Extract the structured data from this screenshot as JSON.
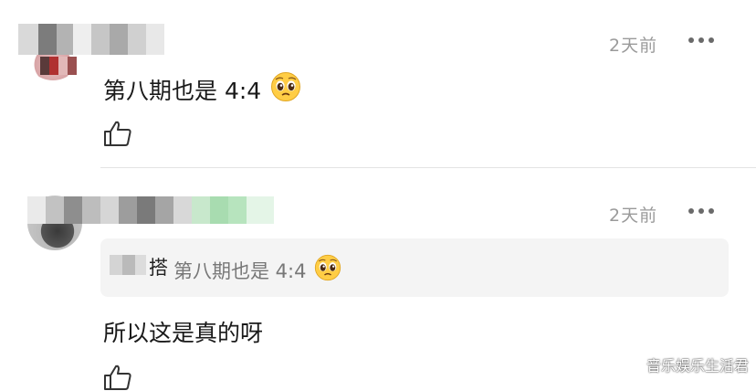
{
  "comments": [
    {
      "time": "2天前",
      "text": "第八期也是 4:4",
      "emoji": "pleading-face-emoji"
    },
    {
      "time": "2天前",
      "quote_name_partial": "搭",
      "quote_text": "第八期也是 4:4",
      "quote_emoji": "pleading-face-emoji",
      "text": "所以这是真的呀"
    }
  ],
  "watermark": "音乐娱乐生活君",
  "colors": {
    "time": "#9a9a9a",
    "quote_bg": "#f4f4f4",
    "divider": "#e4e4e4"
  }
}
